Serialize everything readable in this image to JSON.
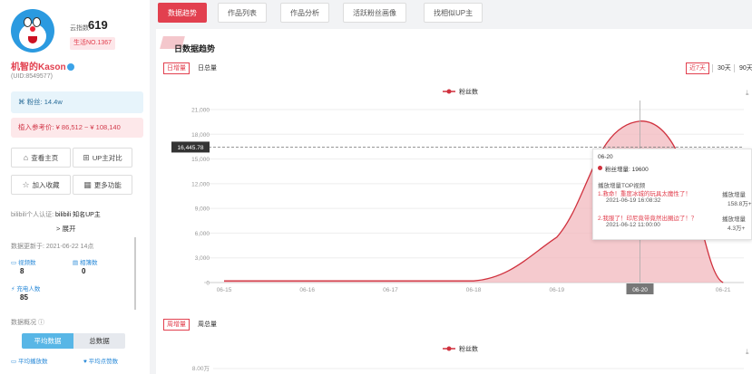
{
  "sidebar": {
    "cloud_index_label": "云指数:",
    "cloud_index_value": "619",
    "rank": "生活NO.1367",
    "username": "机智的Kason",
    "uid": "(UID:8549577)",
    "fans": "粉丝: 14.4w",
    "income": "植入参考价:  ¥ 86,512 ~ ¥ 108,140",
    "buttons": [
      "查看主页",
      "UP主对比",
      "加入收藏",
      "更多功能"
    ],
    "button_icons": [
      "home-icon",
      "compare-icon",
      "star-icon",
      "grid-icon"
    ],
    "cert": "bilibili个人认证:",
    "cert_value": "bilibili 知名UP主",
    "expand": "> 展开",
    "update": "数据更新于: 2021-06-22 14点",
    "stats": [
      {
        "label": "视频数",
        "value": "8"
      },
      {
        "label": "相簿数",
        "value": "0"
      },
      {
        "label": "充电人数",
        "value": "85"
      }
    ],
    "overview": "数据概况 ⓘ",
    "toggle": [
      "平均数据",
      "总数据"
    ],
    "bottom_labels": [
      "平均播放数",
      "平均点赞数"
    ]
  },
  "tabs": [
    "数据趋势",
    "作品列表",
    "作品分析",
    "活跃粉丝画像",
    "找相似UP主"
  ],
  "main": {
    "title": "日数据趋势",
    "subtabs": [
      "日增量",
      "日总量"
    ],
    "ranges": [
      "近7天",
      "30天",
      "90天"
    ],
    "subtabs2": [
      "周增量",
      "周总量"
    ],
    "legend2_yaxis_top": "8.00万"
  },
  "chart_data": {
    "type": "area",
    "legend": "粉丝数",
    "x": [
      "06-15",
      "06-16",
      "06-17",
      "06-18",
      "06-19",
      "06-20",
      "06-21"
    ],
    "y": [
      200,
      200,
      200,
      200,
      5500,
      19600,
      0
    ],
    "yticks": [
      "0",
      "3,000",
      "6,000",
      "9,000",
      "12,000",
      "15,000",
      "18,000",
      "21,000"
    ],
    "ylim": [
      0,
      21000
    ],
    "crosshair_value": "16,445.78",
    "highlight_x": "06-20",
    "colors": {
      "line": "#d0313e",
      "fill": "#f2b8bd"
    }
  },
  "tooltip": {
    "date": "06-20",
    "fans_line": "粉丝增量: 19600",
    "header": "播放增量TOP视频",
    "videos": [
      {
        "title": "1.救命！重度冰城的玩具太魔性了！",
        "date": "2021-06-19 16:08:32",
        "plays_label": "播放增量",
        "plays": "158.8万+"
      },
      {
        "title": "2.我服了！印尼竟带竟然出圈边了！？",
        "date": "2021-06-12 11:00:00",
        "plays_label": "播放增量",
        "plays": "4.3万+"
      }
    ]
  }
}
